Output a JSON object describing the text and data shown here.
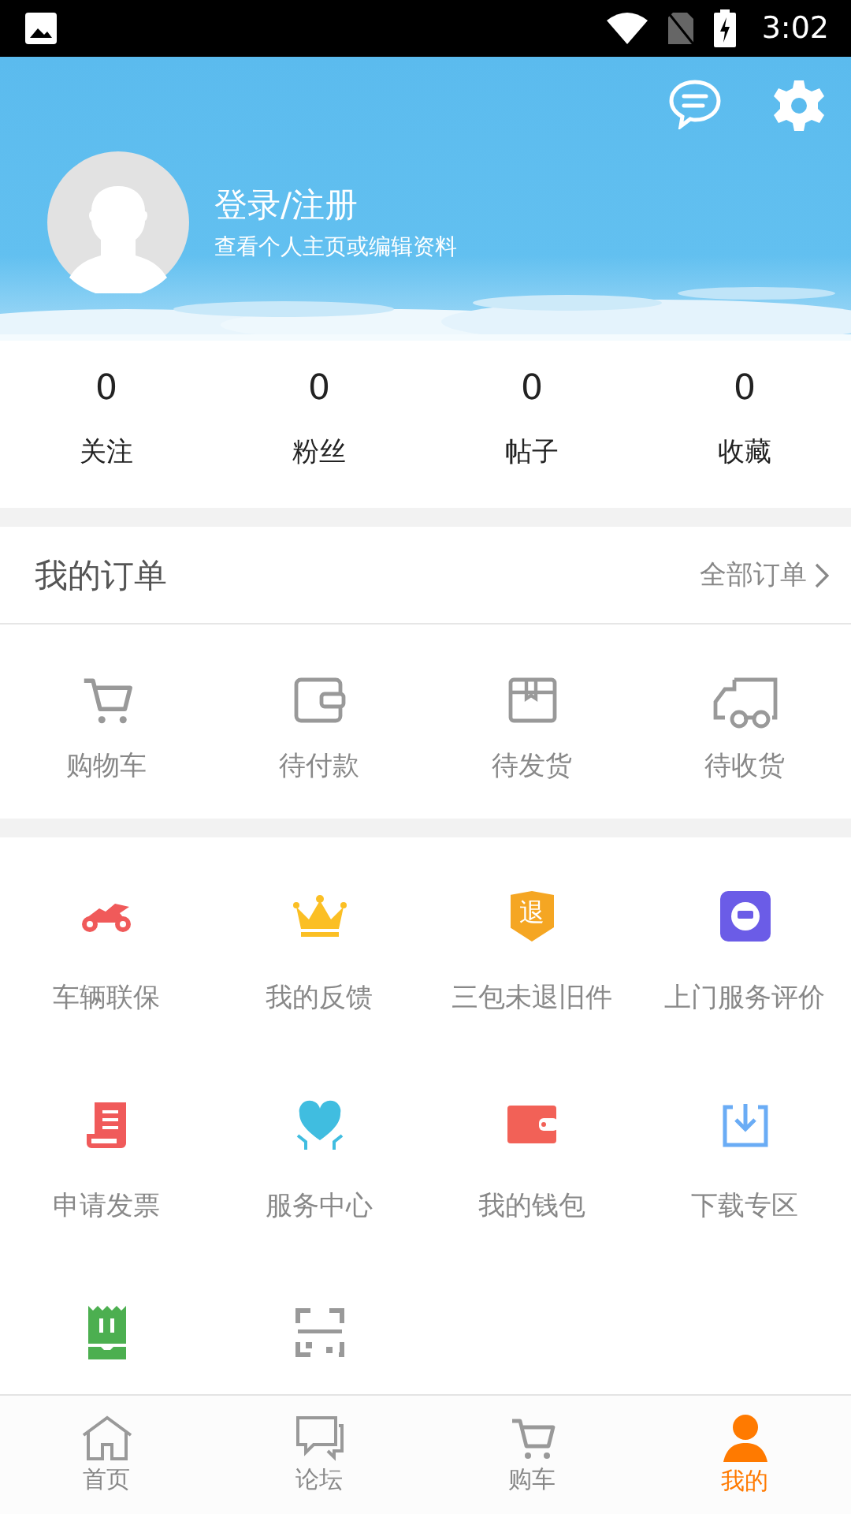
{
  "status_bar": {
    "time": "3:02"
  },
  "profile": {
    "title": "登录/注册",
    "subtitle": "查看个人主页或编辑资料"
  },
  "stats": [
    {
      "value": "0",
      "label": "关注"
    },
    {
      "value": "0",
      "label": "粉丝"
    },
    {
      "value": "0",
      "label": "帖子"
    },
    {
      "value": "0",
      "label": "收藏"
    }
  ],
  "orders": {
    "title": "我的订单",
    "all_link": "全部订单",
    "items": [
      {
        "label": "购物车"
      },
      {
        "label": "待付款"
      },
      {
        "label": "待发货"
      },
      {
        "label": "待收货"
      }
    ]
  },
  "services": [
    {
      "kind": "labeled",
      "label": "车辆联保"
    },
    {
      "kind": "labeled",
      "label": "我的反馈"
    },
    {
      "kind": "labeled",
      "label": "三包未退旧件",
      "badge": "退"
    },
    {
      "kind": "labeled",
      "label": "上门服务评价"
    },
    {
      "kind": "labeled",
      "label": "申请发票"
    },
    {
      "kind": "labeled",
      "label": "服务中心"
    },
    {
      "kind": "labeled",
      "label": "我的钱包"
    },
    {
      "kind": "labeled",
      "label": "下载专区"
    },
    {
      "kind": "covered"
    },
    {
      "kind": "covered"
    }
  ],
  "tabs": [
    {
      "label": "首页",
      "selected": false
    },
    {
      "label": "论坛",
      "selected": false
    },
    {
      "label": "购车",
      "selected": false
    },
    {
      "label": "我的",
      "selected": true
    }
  ]
}
